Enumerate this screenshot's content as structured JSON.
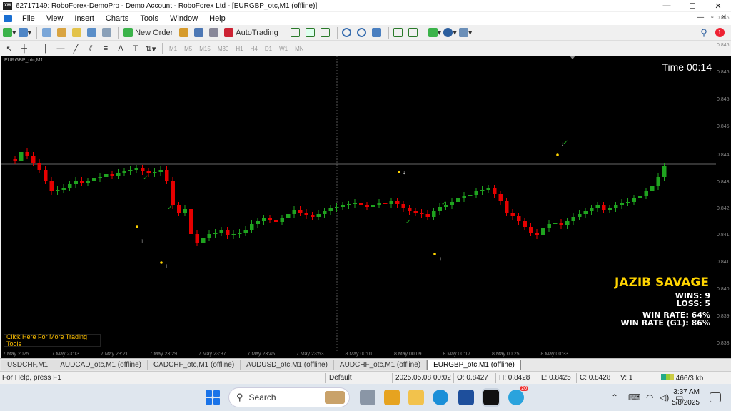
{
  "window": {
    "title": "62717149: RoboForex-DemoPro - Demo Account - RoboForex Ltd - [EURGBP_otc,M1 (offline)]",
    "app_badge": "XM",
    "minimize": "—",
    "maximize": "☐",
    "close": "✕"
  },
  "menu": {
    "items": [
      "File",
      "View",
      "Insert",
      "Charts",
      "Tools",
      "Window",
      "Help"
    ],
    "right": [
      "—",
      "▫",
      "✕"
    ]
  },
  "toolbar": {
    "new_order": "New Order",
    "auto_trading": "AutoTrading",
    "notification_count": "1"
  },
  "drawing_toolbar": {
    "timeframes": [
      "M1",
      "M5",
      "M15",
      "M30",
      "H1",
      "H4",
      "D1",
      "W1",
      "MN"
    ],
    "text_tool": "A",
    "label_tool": "T"
  },
  "chart": {
    "symbol_label": "EURGBP_otc,M1",
    "timer": "Time 00:14",
    "brand": "JAZIB SAVAGE",
    "wins": "WINS: 9",
    "loss": "LOSS: 5",
    "win_rate": "WIN RATE: 64%",
    "win_rate_g1": "WIN RATE (G1): 86%",
    "tools_link": "Click Here For More Trading Tools",
    "price_labels": [
      "0.846",
      "0.846",
      "0.846",
      "0.845",
      "0.845",
      "0.844",
      "0.843",
      "0.842",
      "0.841",
      "0.841",
      "0.840",
      "0.839",
      "0.838"
    ],
    "time_labels": [
      "7 May 2025",
      "7 May 23:13",
      "7 May 23:21",
      "7 May 23:29",
      "7 May 23:37",
      "7 May 23:45",
      "7 May 23:53",
      "8 May 00:01",
      "8 May 00:09",
      "8 May 00:17",
      "8 May 00:25",
      "8 May 00:33"
    ]
  },
  "tabs": [
    "USDCHF,M1",
    "AUDCAD_otc,M1 (offline)",
    "CADCHF_otc,M1 (offline)",
    "AUDUSD_otc,M1 (offline)",
    "AUDCHF_otc,M1 (offline)",
    "EURGBP_otc,M1 (offline)"
  ],
  "active_tab": 5,
  "status": {
    "help": "For Help, press F1",
    "profile": "Default",
    "datetime": "2025.05.08 00:02",
    "open": "O: 0.8427",
    "high": "H: 0.8428",
    "low": "L: 0.8425",
    "close": "C: 0.8428",
    "volume": "V: 1",
    "traffic": "466/3 kb"
  },
  "taskbar": {
    "search_placeholder": "Search",
    "telegram_badge": "20",
    "time": "3:37 AM",
    "date": "5/8/2025"
  },
  "colors": {
    "bull": "#1fa31f",
    "bear": "#e60000",
    "brand": "#ffd400",
    "link": "#ffc000"
  }
}
